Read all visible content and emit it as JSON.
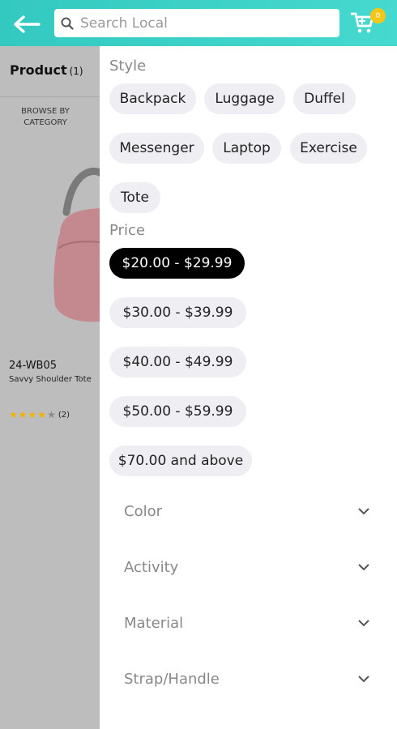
{
  "header": {
    "search_placeholder": "Search Local",
    "cart_count": "0"
  },
  "left_pane": {
    "product_label": "Product",
    "product_count": "(1)",
    "browse_label": "BROWSE BY CATEGORY",
    "product": {
      "sku": "24-WB05",
      "name": "Savvy Shoulder Tote",
      "rating": 4,
      "reviews": "(2)"
    }
  },
  "filters": {
    "style": {
      "title": "Style",
      "options": [
        "Backpack",
        "Luggage",
        "Duffel",
        "Messenger",
        "Laptop",
        "Exercise",
        "Tote"
      ]
    },
    "price": {
      "title": "Price",
      "options": [
        "$20.00 - $29.99",
        "$30.00 - $39.99",
        "$40.00 - $49.99",
        "$50.00 - $59.99",
        "$70.00 and above"
      ],
      "selected": "$20.00 - $29.99"
    },
    "collapsed": [
      "Color",
      "Activity",
      "Material",
      "Strap/Handle"
    ]
  },
  "colors": {
    "header": "#3ccfc6",
    "chip_bg": "#eeeef3",
    "chip_selected_bg": "#000000",
    "badge": "#f5c518",
    "star": "#f0b400"
  },
  "icons": [
    "back-arrow-icon",
    "search-icon",
    "cart-icon",
    "chevron-down-icon",
    "star-icon"
  ]
}
